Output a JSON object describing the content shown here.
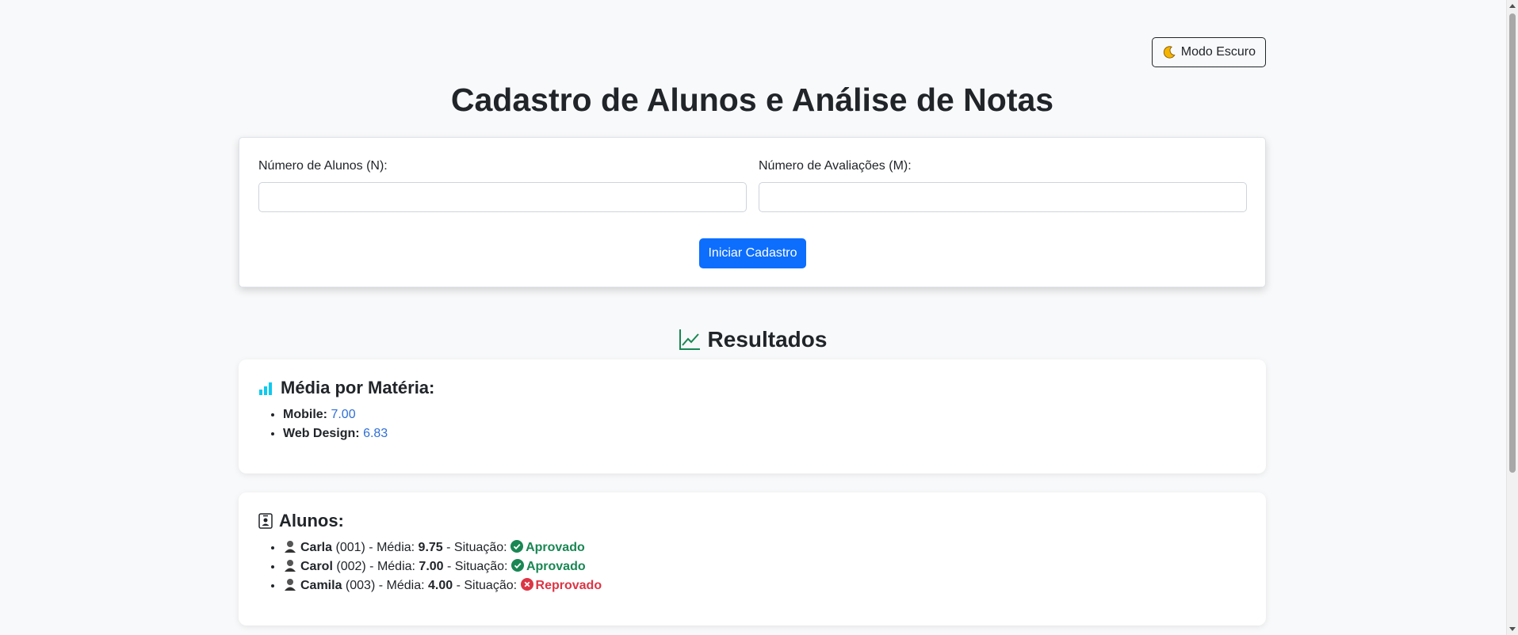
{
  "header": {
    "dark_mode_label": "Modo Escuro",
    "title": "Cadastro de Alunos e Análise de Notas"
  },
  "form": {
    "students_label": "Número de Alunos (N):",
    "students_value": "",
    "assessments_label": "Número de Avaliações (M):",
    "assessments_value": "",
    "start_button": "Iniciar Cadastro"
  },
  "results": {
    "title": "Resultados",
    "subjects_title": "Média por Matéria:",
    "subjects": [
      {
        "name": "Mobile:",
        "average": "7.00"
      },
      {
        "name": "Web Design:",
        "average": "6.83"
      }
    ],
    "students_title": "Alunos:",
    "students": [
      {
        "name": "Carla",
        "id": "(001)",
        "average_label": "- Média:",
        "average": "9.75",
        "status_label": "- Situação:",
        "status": "Aprovado",
        "approved": true
      },
      {
        "name": "Carol",
        "id": "(002)",
        "average_label": "- Média:",
        "average": "7.00",
        "status_label": "- Situação:",
        "status": "Aprovado",
        "approved": true
      },
      {
        "name": "Camila",
        "id": "(003)",
        "average_label": "- Média:",
        "average": "4.00",
        "status_label": "- Situação:",
        "status": "Reprovado",
        "approved": false
      }
    ]
  },
  "colors": {
    "primary": "#0d6efd",
    "approved": "#198754",
    "failed": "#dc3545",
    "average_value": "#2f6fd6",
    "chart_icon": "#0dcaf0",
    "background": "#f8f9fa"
  },
  "icons": {
    "dark_mode": "moon-icon",
    "results": "line-chart-icon",
    "subjects": "bar-chart-icon",
    "students": "person-badge-icon",
    "student": "student-icon",
    "approved": "check-circle-icon",
    "failed": "x-circle-icon"
  }
}
